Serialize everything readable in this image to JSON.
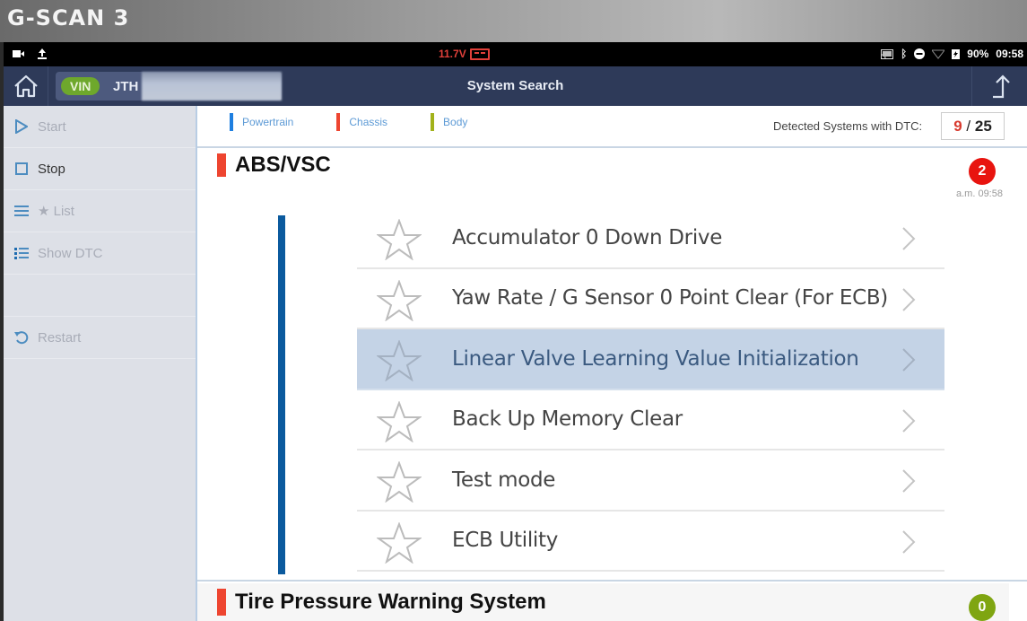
{
  "banner": {
    "logo_text": "G-SCAN 3"
  },
  "statusbar": {
    "left_icons": [
      "video-icon",
      "upload-icon"
    ],
    "voltage": "11.7V",
    "battery_percent": "90%",
    "time": "09:58",
    "right_icons": [
      "cast-icon",
      "bluetooth-icon",
      "do-not-disturb-icon",
      "wifi-icon",
      "battery-charging-icon"
    ]
  },
  "appbar": {
    "title": "System Search",
    "vin_label": "VIN",
    "vin_value": "JTH"
  },
  "sidebar": {
    "items": [
      {
        "label": "Start",
        "icon": "play-icon",
        "enabled": false
      },
      {
        "label": "Stop",
        "icon": "stop-icon",
        "enabled": true
      },
      {
        "label": "★ List",
        "icon": "menu-icon",
        "enabled": false
      },
      {
        "label": "Show DTC",
        "icon": "list-icon",
        "enabled": false
      },
      {
        "label": "",
        "icon": "",
        "enabled": false
      },
      {
        "label": "Restart",
        "icon": "restart-icon",
        "enabled": false
      }
    ]
  },
  "legend": [
    {
      "label": "Powertrain",
      "color": "#1e7fe0"
    },
    {
      "label": "Chassis",
      "color": "#ee4530"
    },
    {
      "label": "Body",
      "color": "#a2b21a"
    }
  ],
  "dtc_summary": {
    "label": "Detected Systems with DTC:",
    "detected": "9",
    "separator": "/",
    "total": "25"
  },
  "systems": [
    {
      "name": "ABS/VSC",
      "dtc_count": "2",
      "time": "a.m. 09:58",
      "functions": [
        {
          "label": "Accumulator 0 Down Drive",
          "favorite": false,
          "selected": false
        },
        {
          "label": "Yaw Rate / G Sensor 0 Point Clear (For ECB)",
          "favorite": false,
          "selected": false
        },
        {
          "label": "Linear Valve Learning Value Initialization",
          "favorite": false,
          "selected": true
        },
        {
          "label": "Back Up Memory Clear",
          "favorite": false,
          "selected": false
        },
        {
          "label": "Test mode",
          "favorite": false,
          "selected": false
        },
        {
          "label": "ECB Utility",
          "favorite": false,
          "selected": false
        }
      ]
    },
    {
      "name": "Tire Pressure Warning System",
      "dtc_count": "0"
    }
  ],
  "colors": {
    "chassis_accent": "#ee4530",
    "selected_row": "#c4d3e6",
    "appbar": "#2e3a59",
    "dtc_badge_red": "#e8140f",
    "dtc_badge_green": "#7fa511"
  }
}
